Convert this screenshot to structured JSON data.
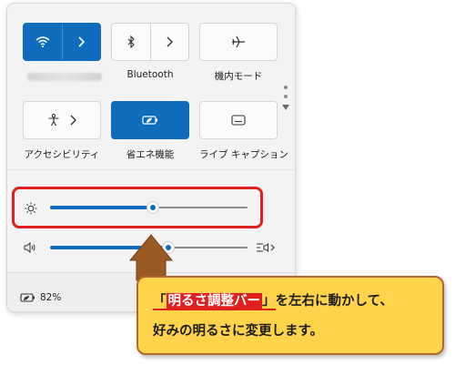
{
  "quick_settings": {
    "tiles": [
      {
        "id": "wifi",
        "label": "",
        "label_blurred": true,
        "active": true,
        "has_chevron": true
      },
      {
        "id": "bluetooth",
        "label": "Bluetooth",
        "active": false,
        "has_chevron": true
      },
      {
        "id": "airplane",
        "label": "機内モード",
        "active": false,
        "has_chevron": false
      },
      {
        "id": "accessibility",
        "label": "アクセシビリティ",
        "active": false,
        "has_chevron": true
      },
      {
        "id": "battery-saver",
        "label": "省エネ機能",
        "active": true,
        "has_chevron": false
      },
      {
        "id": "live-captions",
        "label": "ライブ キャプション",
        "active": false,
        "has_chevron": false
      }
    ],
    "brightness": {
      "level_percent": 52
    },
    "volume": {
      "level_percent": 60
    },
    "battery": {
      "percent_label": "82%"
    },
    "pager": {
      "pages": 2,
      "current": 1
    }
  },
  "callout": {
    "open_bracket": "「",
    "highlight": "明るさ調整バー",
    "close_bracket": "」",
    "line1_rest": "を左右に動かして、",
    "line2": "好みの明るさに変更します。"
  },
  "colors": {
    "accent": "#0f6cbd",
    "highlight_red": "#e02020",
    "callout_fill": "#ffd44a",
    "arrow_brown": "#9a5a24"
  }
}
